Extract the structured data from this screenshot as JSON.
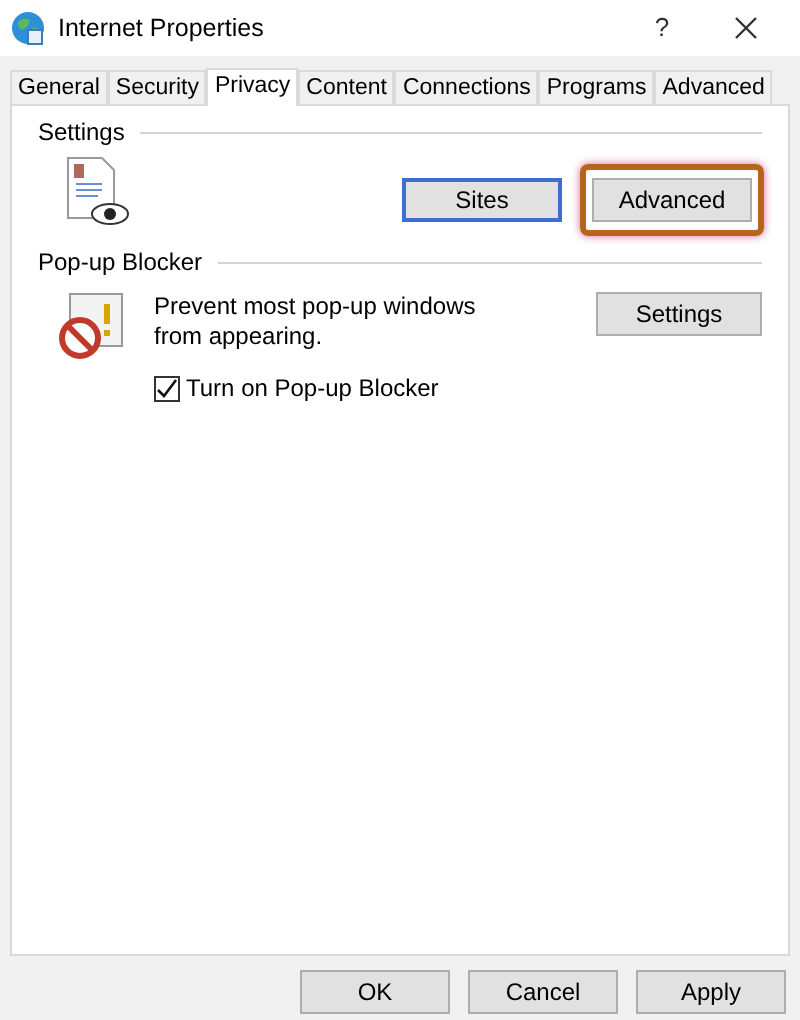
{
  "window": {
    "title": "Internet Properties",
    "help": "?"
  },
  "tabs": [
    {
      "label": "General",
      "selected": false
    },
    {
      "label": "Security",
      "selected": false
    },
    {
      "label": "Privacy",
      "selected": true
    },
    {
      "label": "Content",
      "selected": false
    },
    {
      "label": "Connections",
      "selected": false
    },
    {
      "label": "Programs",
      "selected": false
    },
    {
      "label": "Advanced",
      "selected": false
    }
  ],
  "settings": {
    "heading": "Settings",
    "buttons": [
      {
        "label": "Sites",
        "focused": true,
        "highlighted": false
      },
      {
        "label": "Advanced",
        "focused": false,
        "highlighted": true
      }
    ]
  },
  "popup_blocker": {
    "heading": "Pop-up Blocker",
    "description": "Prevent most pop-up windows from appearing.",
    "settings_button": "Settings",
    "checkbox": {
      "label": "Turn on Pop-up Blocker",
      "checked": true
    }
  },
  "buttons": [
    "OK",
    "Cancel",
    "Apply"
  ]
}
